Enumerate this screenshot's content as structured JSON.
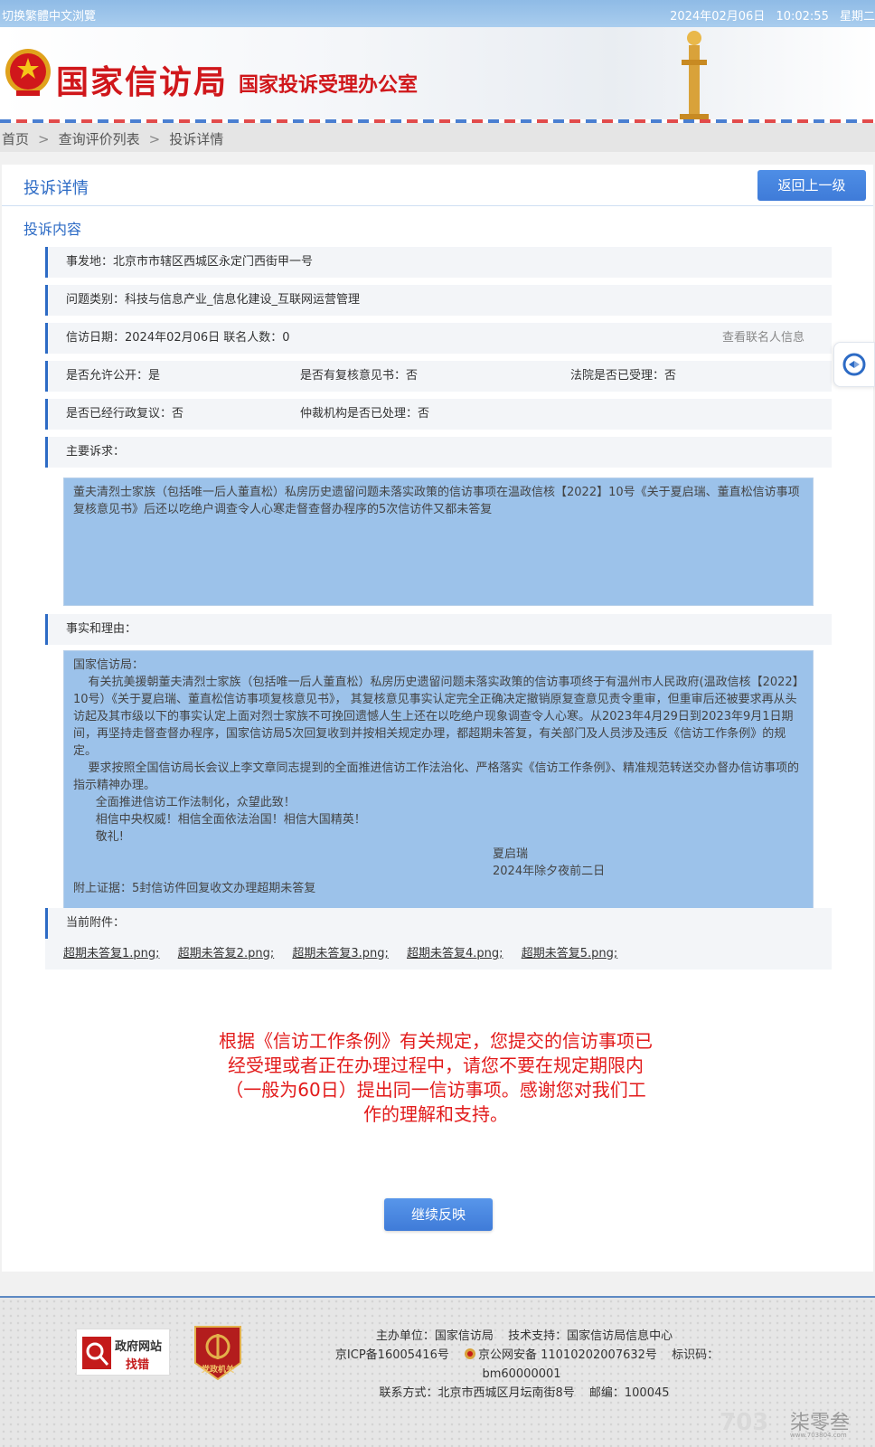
{
  "topbar": {
    "lang_switch": "切换繁體中文浏覽",
    "date": "2024年02月06日",
    "time": "10:02:55",
    "weekday": "星期二"
  },
  "header": {
    "title_main": "国家信访局",
    "title_sub": "国家投诉受理办公室"
  },
  "breadcrumb": {
    "items": [
      "首页",
      "查询评价列表",
      "投诉详情"
    ],
    "separator": ">"
  },
  "card": {
    "title": "投诉详情",
    "back_label": "返回上一级",
    "section": "投诉内容"
  },
  "details": {
    "location": "事发地：北京市市辖区西城区永定门西街甲一号",
    "category": "问题类别：科技与信息产业_信息化建设_互联网运营管理",
    "date_contacts": "信访日期：2024年02月06日 联名人数：0",
    "view_contacts": "查看联名人信息",
    "public": "是否允许公开：是",
    "review_opinion": "是否有复核意见书：否",
    "court": "法院是否已受理：否",
    "admin_review": "是否已经行政复议：否",
    "arbitration": "仲裁机构是否已处理：否",
    "main_claim_label": "主要诉求：",
    "main_claim_text": "董夫清烈士家族（包括唯一后人董直松）私房历史遗留问题未落实政策的信访事项在温政信核【2022】10号《关于夏启瑞、董直松信访事项复核意见书》后还以吃绝户调查令人心寒走督查督办程序的5次信访件又都未答复",
    "facts_label": "事实和理由：",
    "facts_lines": [
      "国家信访局：",
      "    有关抗美援朝董夫清烈士家族（包括唯一后人董直松）私房历史遗留问题未落实政策的信访事项终于有温州市人民政府(温政信核【2022】10号）《关于夏启瑞、董直松信访事项复核意见书》， 其复核意见事实认定完全正确决定撤销原复查意见责令重审，但重审后还被要求再从头访起及其市级以下的事实认定上面对烈士家族不可挽回遗憾人生上还在以吃绝户现象调查令人心寒。从2023年4月29日到2023年9月1日期间，再坚持走督查督办程序，国家信访局5次回复收到并按相关规定办理，都超期未答复，有关部门及人员涉及违反《信访工作条例》的规定。",
      "    要求按照全国信访局长会议上李文章同志提到的全面推进信访工作法治化、严格落实《信访工作条例》、精准规范转送交办督办信访事项的指示精神办理。",
      "      全面推进信访工作法制化，众望此致！",
      "      相信中央权威！相信全面依法治国！相信大国精英！",
      "      敬礼!",
      "                                                                        夏启瑞",
      "                                                                        2024年除夕夜前二日",
      "附上证据：5封信访件回复收文办理超期未答复"
    ],
    "attachments_label": "当前附件：",
    "attachments": [
      "超期未答复1.png;",
      "超期未答复2.png;",
      "超期未答复3.png;",
      "超期未答复4.png;",
      "超期未答复5.png;"
    ]
  },
  "notice": "根据《信访工作条例》有关规定，您提交的信访事项已经受理或者正在办理过程中，请您不要在规定期限内（一般为60日）提出同一信访事项。感谢您对我们工作的理解和支持。",
  "continue_label": "继续反映",
  "footer": {
    "badge_gov_line1": "政府网站",
    "badge_gov_line2": "找错",
    "badge_party": "党政机关",
    "sponsor": "主办单位：国家信访局",
    "tech": "技术支持：国家信访局信息中心",
    "icp": "京ICP备16005416号",
    "police": "京公网安备 11010202007632号",
    "id_code": "标识码：bm60000001",
    "address": "联系方式：北京市西城区月坛南街8号",
    "zip": "邮编：100045",
    "watermark": "柒零叁",
    "watermark_url": "www.703804.com"
  },
  "colors": {
    "accent": "#2d6bc5",
    "notice_red": "#e21b1b",
    "header_red": "#d0171b",
    "textbox_bg": "#9cc2ea"
  }
}
